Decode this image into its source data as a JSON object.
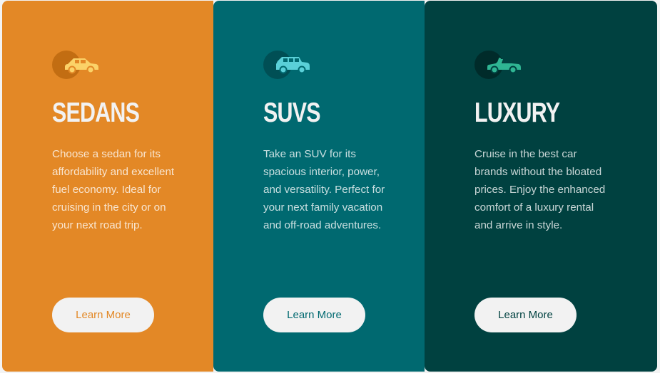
{
  "cards": [
    {
      "icon": "sedan-car-icon",
      "title": "SEDANS",
      "description": "Choose a sedan for its affordability and excellent fuel economy. Ideal for cruising in the city or on your next road trip.",
      "button_label": "Learn More",
      "color": "#e38826"
    },
    {
      "icon": "suv-car-icon",
      "title": "SUVS",
      "description": "Take an SUV for its spacious interior, power, and versatility. Perfect for your next family vacation and off-road adventures.",
      "button_label": "Learn More",
      "color": "#006970"
    },
    {
      "icon": "luxury-car-icon",
      "title": "LUXURY",
      "description": "Cruise in the best car brands without the bloated prices. Enjoy the enhanced comfort of a luxury rental and arrive in style.",
      "button_label": "Learn More",
      "color": "#004140"
    }
  ],
  "colors": {
    "button_bg": "#f2f2f2",
    "text_light": "#f2f2f2"
  }
}
